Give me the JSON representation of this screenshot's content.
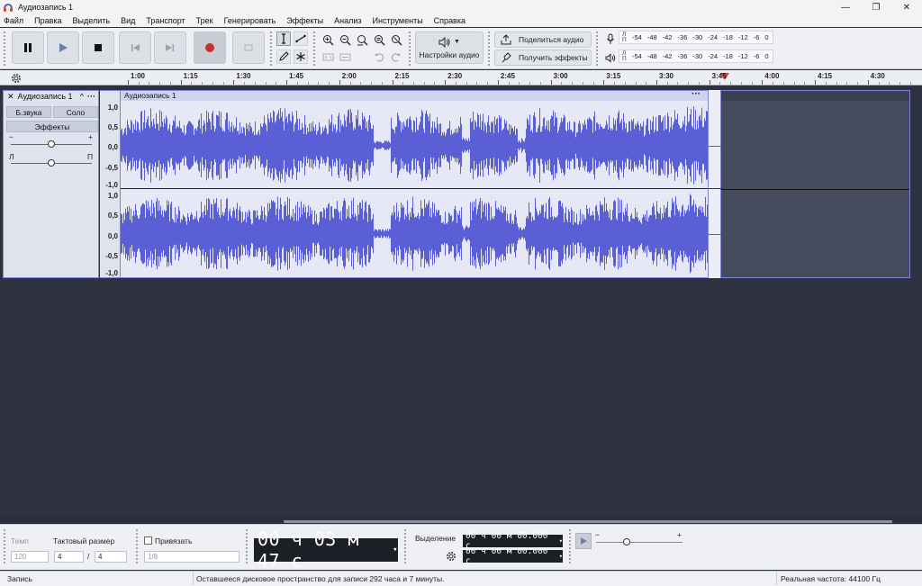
{
  "window": {
    "title": "Аудиозапись 1",
    "minimize": "—",
    "restore": "❐",
    "close": "✕"
  },
  "menu": [
    "Файл",
    "Правка",
    "Выделить",
    "Вид",
    "Транспорт",
    "Трек",
    "Генерировать",
    "Эффекты",
    "Анализ",
    "Инструменты",
    "Справка"
  ],
  "toolbar": {
    "audio_setup_label": "Настройки аудио",
    "share_label": "Поделиться аудио",
    "get_effects_label": "Получить эффекты",
    "meter_scale": [
      "-54",
      "-48",
      "-42",
      "-36",
      "-30",
      "-24",
      "-18",
      "-12",
      "-6",
      "0"
    ],
    "meter_channels_rec": "Л\nП",
    "meter_channels_play": "Л\nП"
  },
  "ruler": {
    "ticks": [
      "1:00",
      "1:15",
      "1:30",
      "1:45",
      "2:00",
      "2:15",
      "2:30",
      "2:45",
      "3:00",
      "3:15",
      "3:30",
      "3:45",
      "4:00",
      "4:15",
      "4:30"
    ]
  },
  "track": {
    "name": "Аудиозапись 1",
    "menu_dots": "···",
    "collapse_glyph": "^",
    "close_glyph": "✕",
    "mute_label": "Б.звука",
    "solo_label": "Соло",
    "effects_label": "Эффекты",
    "gain_minus": "−",
    "gain_plus": "+",
    "pan_left": "Л",
    "pan_right": "П",
    "gain_level": 0.5,
    "pan_level": 0.5,
    "scale_labels": [
      "1,0",
      "0,5",
      "0,0",
      "-0,5",
      "-1,0"
    ],
    "clip_name": "Аудиозапись 1",
    "clip_dots": "···",
    "waveform_color": "#5a5fd6"
  },
  "bottom": {
    "tempo_label": "Темп",
    "tempo_value": "120",
    "time_sig_label": "Тактовый размер",
    "time_sig_num": "4",
    "time_sig_sep": "/",
    "time_sig_den": "4",
    "snap_label": "Привязать",
    "snap_value": "1/8",
    "time_display": "00 ч 03 м 47 с",
    "selection_label": "Выделение",
    "sel_start": "00 ч 00 м 00.000 с",
    "sel_end": "00 ч 00 м 00.000 с",
    "speed_minus": "−",
    "speed_plus": "+",
    "speed_level": 0.35
  },
  "status": {
    "state": "Запись",
    "disk": "Оставшееся дисковое пространство для записи 292 часа и 7 минуты.",
    "rate": "Реальная частота: 44100 Гц"
  }
}
